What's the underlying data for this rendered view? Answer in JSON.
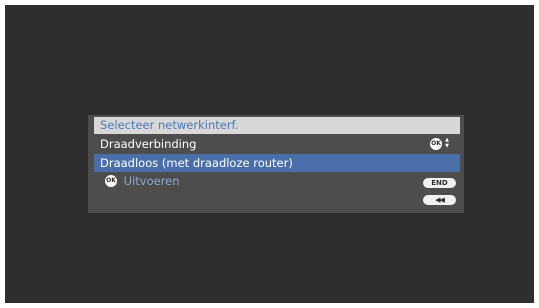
{
  "dialog": {
    "title": "Selecteer netwerkinterf.",
    "options": [
      {
        "label": "Draadverbinding",
        "selected": false
      },
      {
        "label": "Draadloos (met draadloze router)",
        "selected": true
      }
    ],
    "ok_icon_text": "OK",
    "updown_text": "▲\n▼",
    "execute_label": "Uitvoeren",
    "end_button": "END",
    "back_button": "◀◀"
  },
  "colors": {
    "screen_background": "#2e2e2e",
    "dialog_background": "#4d4d4d",
    "title_background": "#d8d8d8",
    "title_text": "#4a78b8",
    "selection_highlight": "#4a6ea8",
    "execute_text": "#8fa9cf"
  },
  "icons": {
    "ok": "ok-circle-icon",
    "updown": "up-down-arrows-icon",
    "back": "rewind-icon"
  }
}
